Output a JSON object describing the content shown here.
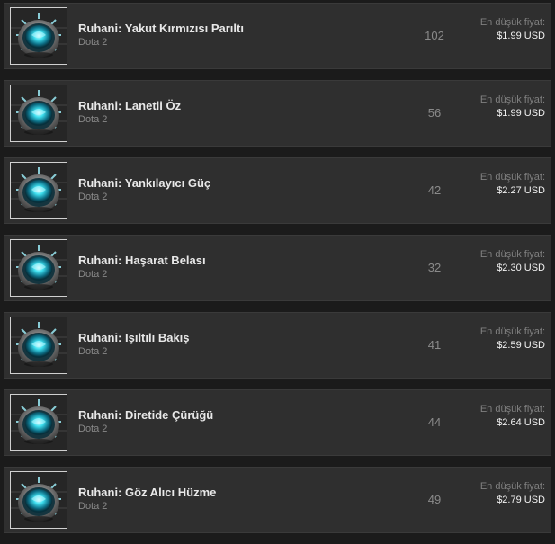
{
  "listings": [
    {
      "name": "Ruhani: Yakut Kırmızısı Parıltı",
      "game": "Dota 2",
      "quantity": "102",
      "price_label": "En düşük fiyat:",
      "price": "$1.99 USD",
      "icon": "spirit-gem-icon"
    },
    {
      "name": "Ruhani: Lanetli Öz",
      "game": "Dota 2",
      "quantity": "56",
      "price_label": "En düşük fiyat:",
      "price": "$1.99 USD",
      "icon": "spirit-gem-icon"
    },
    {
      "name": "Ruhani: Yankılayıcı Güç",
      "game": "Dota 2",
      "quantity": "42",
      "price_label": "En düşük fiyat:",
      "price": "$2.27 USD",
      "icon": "spirit-gem-icon"
    },
    {
      "name": "Ruhani: Haşarat Belası",
      "game": "Dota 2",
      "quantity": "32",
      "price_label": "En düşük fiyat:",
      "price": "$2.30 USD",
      "icon": "spirit-gem-icon"
    },
    {
      "name": "Ruhani: Işıltılı Bakış",
      "game": "Dota 2",
      "quantity": "41",
      "price_label": "En düşük fiyat:",
      "price": "$2.59 USD",
      "icon": "spirit-gem-icon"
    },
    {
      "name": "Ruhani: Diretide Çürüğü",
      "game": "Dota 2",
      "quantity": "44",
      "price_label": "En düşük fiyat:",
      "price": "$2.64 USD",
      "icon": "spirit-gem-icon"
    },
    {
      "name": "Ruhani: Göz Alıcı Hüzme",
      "game": "Dota 2",
      "quantity": "49",
      "price_label": "En düşük fiyat:",
      "price": "$2.79 USD",
      "icon": "spirit-gem-icon"
    }
  ],
  "colors": {
    "row_background": "#2f2f2f",
    "gem_glow": "#3fe0f0",
    "name_text": "#e8e8e8",
    "muted_text": "#8a8a8a"
  }
}
